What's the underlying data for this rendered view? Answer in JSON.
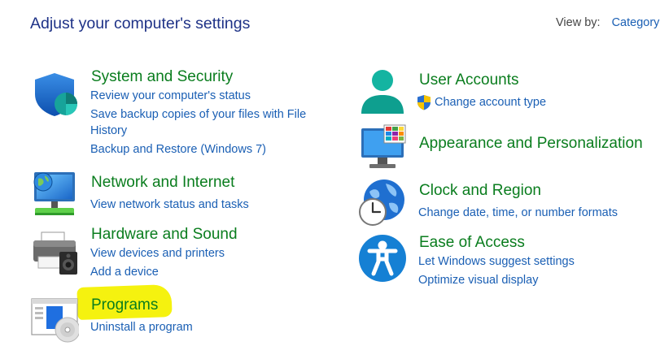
{
  "header": {
    "title": "Adjust your computer's settings",
    "view_by_label": "View by:",
    "view_by_value": "Category"
  },
  "categories": {
    "system_security": {
      "title": "System and Security",
      "icon": "shield-icon",
      "links": [
        "Review your computer's status",
        "Save backup copies of your files with File",
        "History",
        "Backup and Restore (Windows 7)"
      ]
    },
    "network": {
      "title": "Network and Internet",
      "icon": "globe-network-icon",
      "links": [
        "View network status and tasks"
      ]
    },
    "hardware": {
      "title": "Hardware and Sound",
      "icon": "printer-speaker-icon",
      "links": [
        "View devices and printers",
        "Add a device"
      ]
    },
    "programs": {
      "title": "Programs",
      "icon": "programs-disc-icon",
      "links": [
        "Uninstall a program"
      ]
    },
    "user_accounts": {
      "title": "User Accounts",
      "icon": "user-icon",
      "links": [
        "Change account type"
      ]
    },
    "appearance": {
      "title": "Appearance and Personalization",
      "icon": "monitor-palette-icon",
      "links": []
    },
    "clock": {
      "title": "Clock and Region",
      "icon": "clock-globe-icon",
      "links": [
        "Change date, time, or number formats"
      ]
    },
    "ease": {
      "title": "Ease of Access",
      "icon": "accessibility-icon",
      "links": [
        "Let Windows suggest settings",
        "Optimize visual display"
      ]
    }
  },
  "colors": {
    "title_blue": "#1e3287",
    "category_green": "#0a7d1e",
    "link_blue": "#1a5fb4",
    "highlight_yellow": "#f5f20f"
  }
}
